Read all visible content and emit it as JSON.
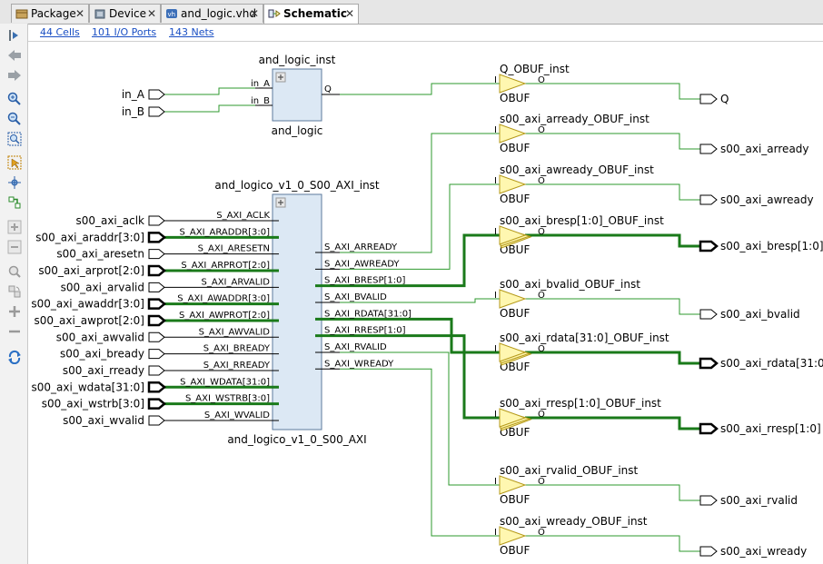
{
  "tabs": [
    {
      "label": "Package",
      "icon": "package-icon",
      "active": false
    },
    {
      "label": "Device",
      "icon": "device-icon",
      "active": false
    },
    {
      "label": "and_logic.vhd",
      "icon": "vhdl-file-icon",
      "active": false
    },
    {
      "label": "Schematic",
      "icon": "schematic-icon",
      "active": true
    }
  ],
  "close_glyph": "✕",
  "stats": {
    "cells": "44 Cells",
    "io_ports": "101 I/O Ports",
    "nets": "143 Nets"
  },
  "toolbar": [
    "expand-icon",
    "back-arrow-icon",
    "forward-arrow-icon",
    "zoom-in-icon",
    "zoom-out-icon",
    "zoom-fit-icon",
    "select-icon",
    "move-icon",
    "auto-route-icon",
    "add-icon",
    "remove-icon",
    "search-icon",
    "regenerate-icon",
    "expand-plus-icon",
    "collapse-minus-icon",
    "refresh-icon"
  ],
  "colors": {
    "net": "#2e9a2e",
    "bus": "#1a7a1a",
    "cell_fill": "#dce8f4",
    "cell_border": "#5c7a9c",
    "buffer_fill": "#fff7b0",
    "buffer_border": "#b59a1a"
  },
  "schematic": {
    "and_logic": {
      "inst": "and_logic_inst",
      "type": "and_logic",
      "inputs": [
        "in_A",
        "in_B"
      ],
      "output": "Q"
    },
    "axi": {
      "inst": "and_logico_v1_0_S00_AXI_inst",
      "type": "and_logico_v1_0_S00_AXI",
      "inputs": [
        "S_AXI_ACLK",
        "S_AXI_ARADDR[3:0]",
        "S_AXI_ARESETN",
        "S_AXI_ARPROT[2:0]",
        "S_AXI_ARVALID",
        "S_AXI_AWADDR[3:0]",
        "S_AXI_AWPROT[2:0]",
        "S_AXI_AWVALID",
        "S_AXI_BREADY",
        "S_AXI_RREADY",
        "S_AXI_WDATA[31:0]",
        "S_AXI_WSTRB[3:0]",
        "S_AXI_WVALID"
      ],
      "outputs": [
        "S_AXI_ARREADY",
        "S_AXI_AWREADY",
        "S_AXI_BRESP[1:0]",
        "S_AXI_BVALID",
        "S_AXI_RDATA[31:0]",
        "S_AXI_RRESP[1:0]",
        "S_AXI_RVALID",
        "S_AXI_WREADY"
      ]
    },
    "in_ports_top": [
      "in_A",
      "in_B"
    ],
    "in_ports_axi": [
      "s00_axi_aclk",
      "s00_axi_araddr[3:0]",
      "s00_axi_aresetn",
      "s00_axi_arprot[2:0]",
      "s00_axi_arvalid",
      "s00_axi_awaddr[3:0]",
      "s00_axi_awprot[2:0]",
      "s00_axi_awvalid",
      "s00_axi_bready",
      "s00_axi_rready",
      "s00_axi_wdata[31:0]",
      "s00_axi_wstrb[3:0]",
      "s00_axi_wvalid"
    ],
    "buffers": [
      {
        "inst": "Q_OBUF_inst",
        "type": "OBUF",
        "bus": false,
        "port": "Q"
      },
      {
        "inst": "s00_axi_arready_OBUF_inst",
        "type": "OBUF",
        "bus": false,
        "port": "s00_axi_arready"
      },
      {
        "inst": "s00_axi_awready_OBUF_inst",
        "type": "OBUF",
        "bus": false,
        "port": "s00_axi_awready"
      },
      {
        "inst": "s00_axi_bresp[1:0]_OBUF_inst",
        "type": "OBUF",
        "bus": true,
        "port": "s00_axi_bresp[1:0]"
      },
      {
        "inst": "s00_axi_bvalid_OBUF_inst",
        "type": "OBUF",
        "bus": false,
        "port": "s00_axi_bvalid"
      },
      {
        "inst": "s00_axi_rdata[31:0]_OBUF_inst",
        "type": "OBUF",
        "bus": true,
        "port": "s00_axi_rdata[31:0]"
      },
      {
        "inst": "s00_axi_rresp[1:0]_OBUF_inst",
        "type": "OBUF",
        "bus": true,
        "port": "s00_axi_rresp[1:0]"
      },
      {
        "inst": "s00_axi_rvalid_OBUF_inst",
        "type": "OBUF",
        "bus": false,
        "port": "s00_axi_rvalid"
      },
      {
        "inst": "s00_axi_wready_OBUF_inst",
        "type": "OBUF",
        "bus": false,
        "port": "s00_axi_wready"
      }
    ],
    "buf_pin_in": "I",
    "buf_pin_out": "O"
  }
}
